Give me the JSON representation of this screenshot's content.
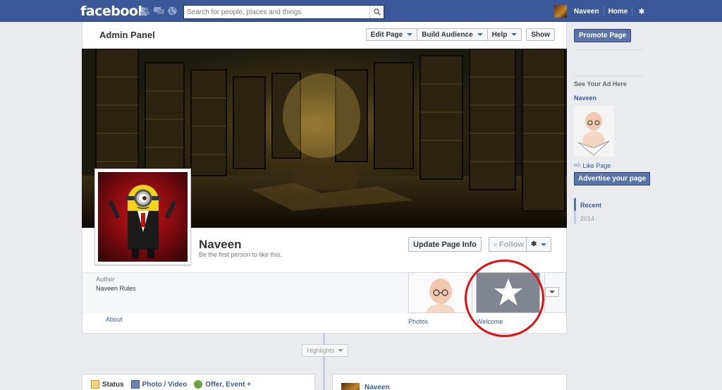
{
  "topbar": {
    "logo": "facebook",
    "search_placeholder": "Search for people, places and things",
    "user_name": "Naveen",
    "home_label": "Home"
  },
  "admin_panel": {
    "title": "Admin Panel",
    "buttons": [
      {
        "label": "Edit Page",
        "dropdown": true
      },
      {
        "label": "Build Audience",
        "dropdown": true
      },
      {
        "label": "Help",
        "dropdown": true
      },
      {
        "label": "Show",
        "dropdown": false
      }
    ]
  },
  "page": {
    "name": "Naveen",
    "subtitle": "Be the first person to like this.",
    "update_button": "Update Page Info",
    "follow_button": "Follow",
    "author_label": "Author",
    "author_value": "Naveen Rules",
    "about_link": "About",
    "tiles": [
      {
        "label": "Photos"
      },
      {
        "label": "Welcome"
      }
    ]
  },
  "timeline": {
    "highlights_label": "Highlights",
    "composer": [
      {
        "label": "Status",
        "icon": "status-icon"
      },
      {
        "label": "Photo / Video",
        "icon": "photo-icon"
      },
      {
        "label": "Offer, Event +",
        "icon": "offer-icon"
      }
    ],
    "post_author": "Naveen"
  },
  "right_column": {
    "promote_label": "Promote Page",
    "see_ad_label": "See Your Ad Here",
    "ad_name": "Naveen",
    "like_page_label": "Like Page",
    "advertise_label": "Advertise your page",
    "recent_label": "Recent",
    "year_label": "2014"
  },
  "colors": {
    "brand_blue": "#3b5998",
    "highlight_circle": "#e01010"
  }
}
